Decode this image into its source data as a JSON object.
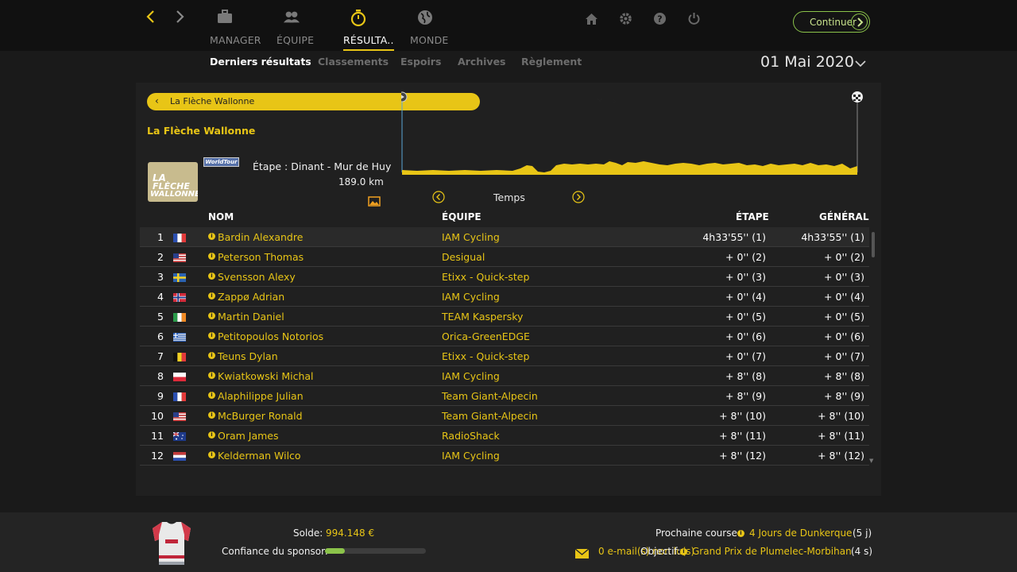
{
  "nav": {
    "tabs": [
      {
        "label": "MANAGER",
        "icon": "briefcase-icon",
        "active": false
      },
      {
        "label": "ÉQUIPE",
        "icon": "team-icon",
        "active": false
      },
      {
        "label": "RÉSULTA..",
        "icon": "stopwatch-icon",
        "active": true
      },
      {
        "label": "MONDE",
        "icon": "globe-icon",
        "active": false
      }
    ],
    "system_icons": [
      "home-icon",
      "gear-icon",
      "help-icon",
      "power-icon"
    ],
    "continue_label": "Continuer"
  },
  "subtabs": [
    {
      "label": "Derniers résultats",
      "active": true
    },
    {
      "label": "Classements",
      "active": false
    },
    {
      "label": "Espoirs",
      "active": false
    },
    {
      "label": "Archives",
      "active": false
    },
    {
      "label": "Règlement",
      "active": false
    }
  ],
  "date": "01 Mai 2020",
  "race": {
    "selector_name": "La Flèche Wallonne",
    "title": "La Flèche Wallonne",
    "badge": "WorldTour",
    "logo_text": "LA FLÈCHE WALLONNE",
    "stage": "Étape : Dinant - Mur de Huy",
    "distance": "189.0 km",
    "mode_label": "Temps"
  },
  "table": {
    "headers": {
      "name": "NOM",
      "team": "ÉQUIPE",
      "stage": "ÉTAPE",
      "general": "GÉNÉRAL"
    },
    "rows": [
      {
        "pos": "1",
        "flag": "FR",
        "name": "Bardin Alexandre",
        "team": "IAM Cycling",
        "stage": "4h33'55'' (1)",
        "general": "4h33'55'' (1)"
      },
      {
        "pos": "2",
        "flag": "US",
        "name": "Peterson Thomas",
        "team": "Desigual",
        "stage": "+ 0'' (2)",
        "general": "+ 0'' (2)"
      },
      {
        "pos": "3",
        "flag": "SE",
        "name": "Svensson Alexy",
        "team": "Etixx - Quick-step",
        "stage": "+ 0'' (3)",
        "general": "+ 0'' (3)"
      },
      {
        "pos": "4",
        "flag": "NO",
        "name": "Zappø Adrian",
        "team": "IAM Cycling",
        "stage": "+ 0'' (4)",
        "general": "+ 0'' (4)"
      },
      {
        "pos": "5",
        "flag": "IE",
        "name": "Martin Daniel",
        "team": "TEAM Kaspersky",
        "stage": "+ 0'' (5)",
        "general": "+ 0'' (5)"
      },
      {
        "pos": "6",
        "flag": "GR",
        "name": "Petitopoulos Notorios",
        "team": "Orica-GreenEDGE",
        "stage": "+ 0'' (6)",
        "general": "+ 0'' (6)"
      },
      {
        "pos": "7",
        "flag": "BE",
        "name": "Teuns Dylan",
        "team": "Etixx - Quick-step",
        "stage": "+ 0'' (7)",
        "general": "+ 0'' (7)"
      },
      {
        "pos": "8",
        "flag": "PL",
        "name": "Kwiatkowski Michal",
        "team": "IAM Cycling",
        "stage": "+ 8'' (8)",
        "general": "+ 8'' (8)"
      },
      {
        "pos": "9",
        "flag": "FR",
        "name": "Alaphilippe Julian",
        "team": "Team Giant-Alpecin",
        "stage": "+ 8'' (9)",
        "general": "+ 8'' (9)"
      },
      {
        "pos": "10",
        "flag": "US",
        "name": "McBurger Ronald",
        "team": "Team Giant-Alpecin",
        "stage": "+ 8'' (10)",
        "general": "+ 8'' (10)"
      },
      {
        "pos": "11",
        "flag": "AU",
        "name": "Oram James",
        "team": "RadioShack",
        "stage": "+ 8'' (11)",
        "general": "+ 8'' (11)"
      },
      {
        "pos": "12",
        "flag": "NL",
        "name": "Kelderman Wilco",
        "team": "IAM Cycling",
        "stage": "+ 8'' (12)",
        "general": "+ 8'' (12)"
      }
    ]
  },
  "footer": {
    "balance_label": "Solde:",
    "balance_value": "994.148 €",
    "sponsor_label": "Confiance du sponsor:",
    "sponsor_confidence": 0.2,
    "next_race_label": "Prochaine course:",
    "next_race_name": "4 Jours de Dunkerque",
    "next_race_days": "(5 j)",
    "emails": "0 e-mail(s) non lu(s)",
    "objective_label": "Objectif:",
    "objective_name": "Grand Prix de Plumelec-Morbihan",
    "objective_time": "(4 s)"
  },
  "colors": {
    "accent": "#e8c516",
    "confirm": "#8bc34a",
    "background": "#1a1a1a"
  }
}
